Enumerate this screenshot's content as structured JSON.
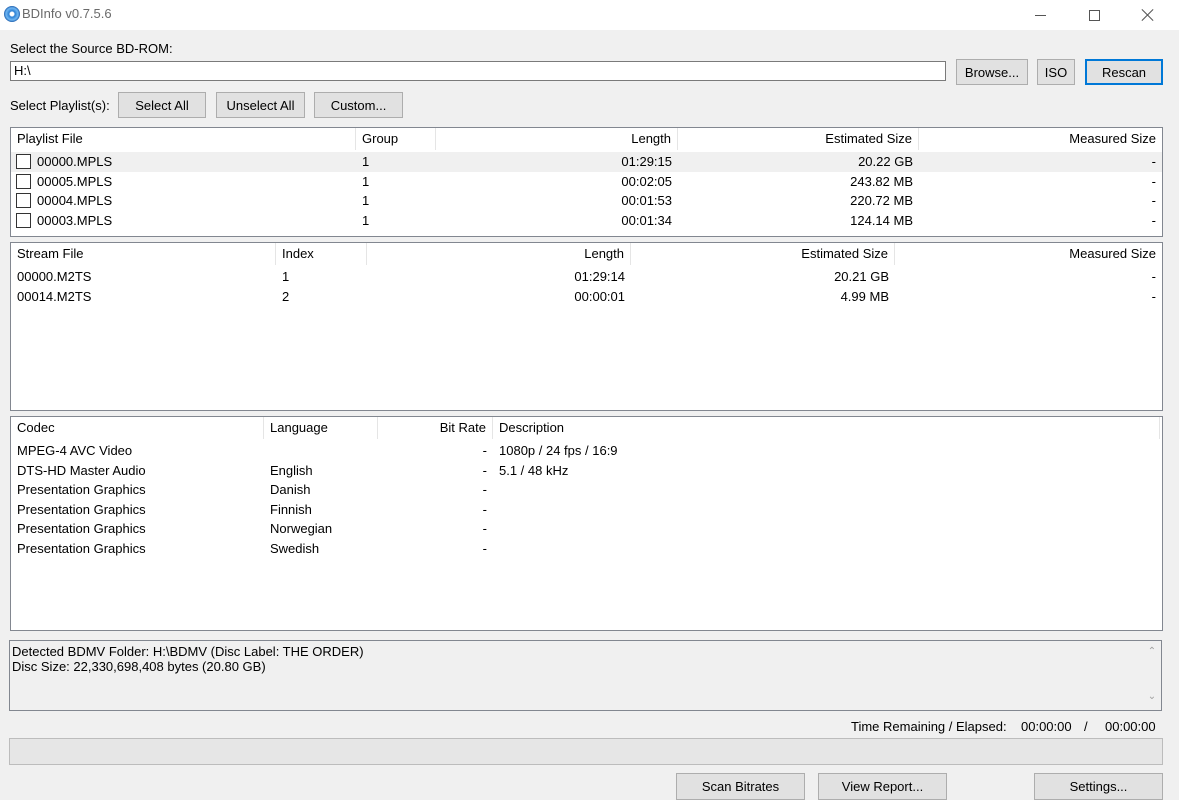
{
  "window": {
    "title": "BDInfo v0.7.5.6"
  },
  "source": {
    "label": "Select the Source BD-ROM:",
    "path": "H:\\",
    "browse": "Browse...",
    "iso": "ISO",
    "rescan": "Rescan"
  },
  "playlist_select": {
    "label": "Select Playlist(s):",
    "select_all": "Select All",
    "unselect_all": "Unselect All",
    "custom": "Custom..."
  },
  "playlists": {
    "headers": {
      "file": "Playlist File",
      "group": "Group",
      "length": "Length",
      "est": "Estimated Size",
      "measured": "Measured Size"
    },
    "rows": [
      {
        "file": "00000.MPLS",
        "group": "1",
        "length": "01:29:15",
        "est": "20.22 GB",
        "measured": "-"
      },
      {
        "file": "00005.MPLS",
        "group": "1",
        "length": "00:02:05",
        "est": "243.82 MB",
        "measured": "-"
      },
      {
        "file": "00004.MPLS",
        "group": "1",
        "length": "00:01:53",
        "est": "220.72 MB",
        "measured": "-"
      },
      {
        "file": "00003.MPLS",
        "group": "1",
        "length": "00:01:34",
        "est": "124.14 MB",
        "measured": "-"
      }
    ]
  },
  "streams": {
    "headers": {
      "file": "Stream File",
      "index": "Index",
      "length": "Length",
      "est": "Estimated Size",
      "measured": "Measured Size"
    },
    "rows": [
      {
        "file": "00000.M2TS",
        "index": "1",
        "length": "01:29:14",
        "est": "20.21 GB",
        "measured": "-"
      },
      {
        "file": "00014.M2TS",
        "index": "2",
        "length": "00:00:01",
        "est": "4.99 MB",
        "measured": "-"
      }
    ]
  },
  "codecs": {
    "headers": {
      "codec": "Codec",
      "language": "Language",
      "bitrate": "Bit Rate",
      "description": "Description"
    },
    "rows": [
      {
        "codec": "MPEG-4 AVC Video",
        "language": "",
        "bitrate": "-",
        "description": "1080p / 24 fps / 16:9"
      },
      {
        "codec": "DTS-HD Master Audio",
        "language": "English",
        "bitrate": "-",
        "description": "5.1 / 48 kHz"
      },
      {
        "codec": "Presentation Graphics",
        "language": "Danish",
        "bitrate": "-",
        "description": ""
      },
      {
        "codec": "Presentation Graphics",
        "language": "Finnish",
        "bitrate": "-",
        "description": ""
      },
      {
        "codec": "Presentation Graphics",
        "language": "Norwegian",
        "bitrate": "-",
        "description": ""
      },
      {
        "codec": "Presentation Graphics",
        "language": "Swedish",
        "bitrate": "-",
        "description": ""
      }
    ]
  },
  "status": {
    "line1": "Detected BDMV Folder: H:\\BDMV (Disc Label: THE ORDER)",
    "line2": "Disc Size: 22,330,698,408 bytes (20.80 GB)"
  },
  "timer": {
    "label": "Time Remaining / Elapsed:",
    "remaining": "00:00:00",
    "separator": "/",
    "elapsed": "00:00:00"
  },
  "progress": {
    "value": 0
  },
  "footer": {
    "scan_bitrates": "Scan Bitrates",
    "view_report": "View Report...",
    "settings": "Settings..."
  },
  "icons": {
    "app": "bluray-disc-icon",
    "scroll_up": "scroll-up-icon",
    "scroll_down": "scroll-down-icon"
  }
}
